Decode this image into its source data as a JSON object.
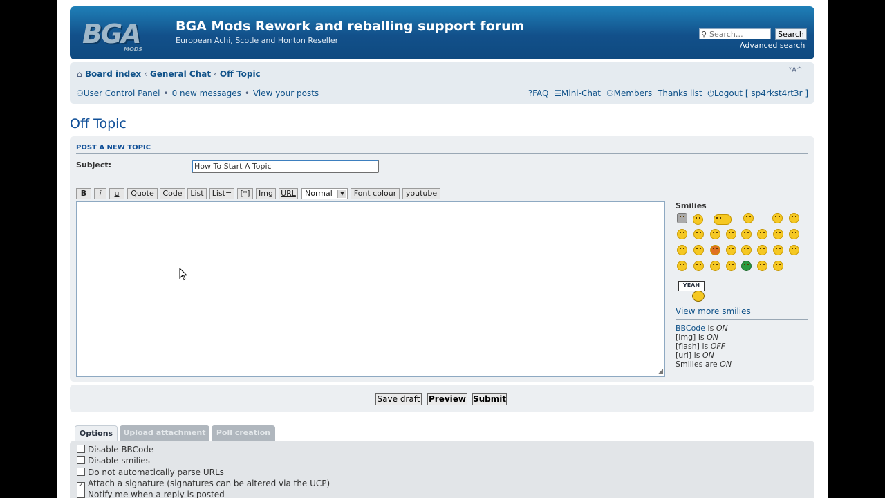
{
  "header": {
    "logo_text": "BGA",
    "logo_sub": "MODS",
    "title": "BGA Mods Rework and reballing support forum",
    "description": "European Achi, Scotle and Honton Reseller",
    "search_placeholder": "Search…",
    "search_button": "Search",
    "advanced_search": "Advanced search"
  },
  "breadcrumb": {
    "items": [
      "Board index",
      "General Chat",
      "Off Topic"
    ],
    "separator": "‹"
  },
  "font_size_control": "ᵛA^",
  "user_nav": {
    "ucp": "User Control Panel",
    "sep": "•",
    "new_messages": "0 new messages",
    "view_posts": "View your posts"
  },
  "right_nav": {
    "faq": "FAQ",
    "minichat": "Mini-Chat",
    "members": "Members",
    "thanks": "Thanks list",
    "logout": "Logout [ sp4rkst4rt3r ]"
  },
  "forum_title": "Off Topic",
  "post": {
    "heading": "POST A NEW TOPIC",
    "subject_label": "Subject:",
    "subject_value": "How To Start A Topic"
  },
  "toolbar": {
    "bold": "B",
    "italic": "i",
    "underline": "u",
    "quote": "Quote",
    "code": "Code",
    "list": "List",
    "list_ordered": "List=",
    "list_item": "[*]",
    "img": "Img",
    "url": "URL",
    "font_size": "Normal",
    "font_colour": "Font colour",
    "youtube": "youtube"
  },
  "smilies": {
    "label": "Smilies",
    "yeah_text": "YEAH",
    "view_more": "View more smilies"
  },
  "bbcode_status": [
    {
      "key": "BBCode",
      "text": " is ",
      "value": "ON"
    },
    {
      "key": "[img]",
      "text": " is ",
      "value": "ON"
    },
    {
      "key": "[flash]",
      "text": " is ",
      "value": "OFF"
    },
    {
      "key": "[url]",
      "text": " is ",
      "value": "ON"
    },
    {
      "key": "Smilies",
      "text": " are ",
      "value": "ON"
    }
  ],
  "buttons": {
    "save_draft": "Save draft",
    "preview": "Preview",
    "submit": "Submit"
  },
  "tabs": [
    "Options",
    "Upload attachment",
    "Poll creation"
  ],
  "options": [
    {
      "label": "Disable BBCode",
      "checked": false
    },
    {
      "label": "Disable smilies",
      "checked": false
    },
    {
      "label": "Do not automatically parse URLs",
      "checked": false
    },
    {
      "label": "Attach a signature (signatures can be altered via the UCP)",
      "checked": true
    },
    {
      "label": "Notify me when a reply is posted",
      "checked": false
    }
  ],
  "colors": {
    "header_blue": "#12508a",
    "link_blue": "#105289",
    "panel_bg": "#eceff2",
    "accent_cyan": "#29c6e4"
  }
}
